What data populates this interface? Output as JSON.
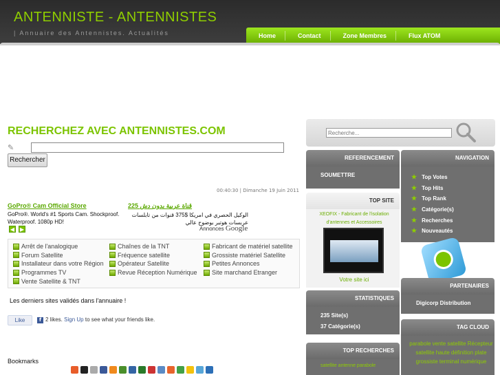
{
  "site": {
    "title": "ANTENNISTE - ANTENNISTES",
    "tagline": "| Annuaire des Antennistes. Actualités"
  },
  "nav": [
    "Home",
    "Contact",
    "Zone Membres",
    "Flux ATOM"
  ],
  "main": {
    "title": "RECHERCHEZ AVEC ANTENNISTES.COM",
    "search_button": "Rechercher",
    "datetime": "00:40:30 | Dimanche 19 Juin 2011"
  },
  "ads": {
    "ad1_title": "GoPro® Cam Official Store",
    "ad1_text": "GoPro®. World's #1 Sports Cam. Shockproof. Waterproof. 1080p HD!",
    "ad2_title": "225 قناة عربية بدون دش",
    "ad2_text": "الوكيل الحصري في امريكا $375 قنوات من تابلسات عربسات هوتبر بوضوح عالي",
    "annonces": "Annonces",
    "google": "Google"
  },
  "categories": {
    "col1": [
      "Arrêt de l'analogique",
      "Forum Satellite",
      "Installateur dans votre Région",
      "Programmes TV",
      "Vente Satellite & TNT"
    ],
    "col2": [
      "Chaînes de la TNT",
      "Fréquence satellite",
      "Opérateur Satellite",
      "Revue Réception Numérique"
    ],
    "col3": [
      "Fabricant de matériel satellite",
      "Grossiste matériel Satellite",
      "Petites Annonces",
      "Site marchand Etranger"
    ]
  },
  "validated_text": "Les derniers sites validés dans l'annuaire !",
  "facebook": {
    "like": "Like",
    "count_text": "2 likes.",
    "signup": "Sign Up",
    "rest": "to see what your friends like."
  },
  "bookmarks_label": "Bookmarks",
  "sidebar": {
    "search_placeholder": "Recherche...",
    "referencement": {
      "head": "REFERENCEMENT",
      "link": "SOUMETTRE"
    },
    "navigation": {
      "head": "NAVIGATION",
      "items": [
        "Top Votes",
        "Top Hits",
        "Top Rank",
        "Catégorie(s)",
        "Recherches",
        "Nouveautés"
      ]
    },
    "topsite": {
      "head": "TOP SITE",
      "caption": "XEOFIX - Fabricant de l'isolation d'antennes et Accessoires",
      "vote": "Votre site ici"
    },
    "partenaires": {
      "head": "PARTENAIRES",
      "item": "Digicorp Distribution"
    },
    "statistiques": {
      "head": "STATISTIQUES",
      "sites": "235 Site(s)",
      "categories": "37 Catégorie(s)"
    },
    "tagcloud": {
      "head": "TAG CLOUD",
      "text": "parabole vente satellite Récepteur satellite haute définition plate grossiste terminal numérique"
    },
    "top_recherches": {
      "head": "TOP RECHERCHES",
      "text": "satellite antenne parabole"
    }
  },
  "colors": {
    "accent": "#8fce00",
    "header": "#333333",
    "panel": "#7a7a7a"
  }
}
